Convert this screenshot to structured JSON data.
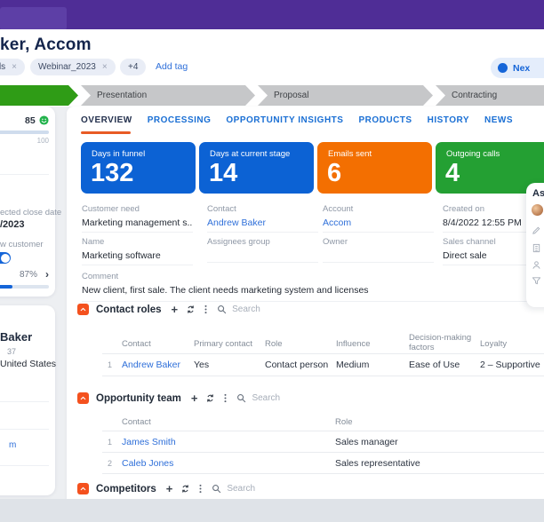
{
  "header": {
    "title": "ker, Accom"
  },
  "tags": {
    "clipped_tag": "ds",
    "webinar_tag": "Webinar_2023",
    "more_count": "+4",
    "add_tag_label": "Add tag"
  },
  "next_button": {
    "label": "Nex"
  },
  "pipeline": {
    "stages": [
      {
        "label": "",
        "state": "active"
      },
      {
        "label": "Presentation",
        "state": "upcoming"
      },
      {
        "label": "Proposal",
        "state": "upcoming"
      },
      {
        "label": "Contracting",
        "state": "upcoming"
      }
    ],
    "active_color": "#2f9c16",
    "inactive_color": "#c6c7c9"
  },
  "tabs": [
    {
      "label": "OVERVIEW",
      "active": true
    },
    {
      "label": "PROCESSING",
      "active": false
    },
    {
      "label": "OPPORTUNITY INSIGHTS",
      "active": false
    },
    {
      "label": "PRODUCTS",
      "active": false
    },
    {
      "label": "HISTORY",
      "active": false
    },
    {
      "label": "NEWS",
      "active": false
    }
  ],
  "kpis": [
    {
      "label": "Days in funnel",
      "value": "132",
      "color": "#0c62d4"
    },
    {
      "label": "Days at current stage",
      "value": "14",
      "color": "#0c62d4"
    },
    {
      "label": "Emails sent",
      "value": "6",
      "color": "#f36f01"
    },
    {
      "label": "Outgoing calls",
      "value": "4",
      "color": "#24a033"
    }
  ],
  "fields": {
    "customer_need": {
      "label": "Customer need",
      "value": "Marketing management s..."
    },
    "contact": {
      "label": "Contact",
      "value": "Andrew Baker"
    },
    "account": {
      "label": "Account",
      "value": "Accom"
    },
    "created_on": {
      "label": "Created on",
      "value": "8/4/2022 12:55 PM"
    },
    "name": {
      "label": "Name",
      "value": "Marketing software"
    },
    "assignees_group": {
      "label": "Assignees group",
      "value": ""
    },
    "owner": {
      "label": "Owner",
      "value": ""
    },
    "sales_channel": {
      "label": "Sales channel",
      "value": "Direct sale"
    },
    "comment": {
      "label": "Comment",
      "value": "New client, first sale. The client needs marketing system and licenses"
    }
  },
  "contact_roles": {
    "title": "Contact roles",
    "search_placeholder": "Search",
    "headers": [
      "Contact",
      "Primary contact",
      "Role",
      "Influence",
      "Decision-making factors",
      "Loyalty"
    ],
    "rows": [
      {
        "num": "1",
        "contact": "Andrew Baker",
        "primary": "Yes",
        "role": "Contact person",
        "influence": "Medium",
        "factors": "Ease of Use",
        "loyalty": "2 – Supportive"
      }
    ]
  },
  "opportunity_team": {
    "title": "Opportunity team",
    "search_placeholder": "Search",
    "headers": [
      "Contact",
      "Role"
    ],
    "rows": [
      {
        "num": "1",
        "contact": "James Smith",
        "role": "Sales manager"
      },
      {
        "num": "2",
        "contact": "Caleb Jones",
        "role": "Sales representative"
      }
    ]
  },
  "competitors": {
    "title": "Competitors",
    "search_placeholder": "Search"
  },
  "sidebar": {
    "score": "85",
    "scale_max": "100",
    "close_date_label": "ected close date",
    "close_date_value": "/2023",
    "customer_label": "w customer",
    "percent": "87%",
    "contact_card": {
      "name": "Baker",
      "number": "37",
      "country": "United States",
      "link_fragment": "m"
    }
  },
  "side_panel": {
    "title_fragment": "As"
  },
  "icons": {
    "close": "×",
    "plus": "+",
    "caret_down": "▾",
    "chevron_right": "›"
  }
}
